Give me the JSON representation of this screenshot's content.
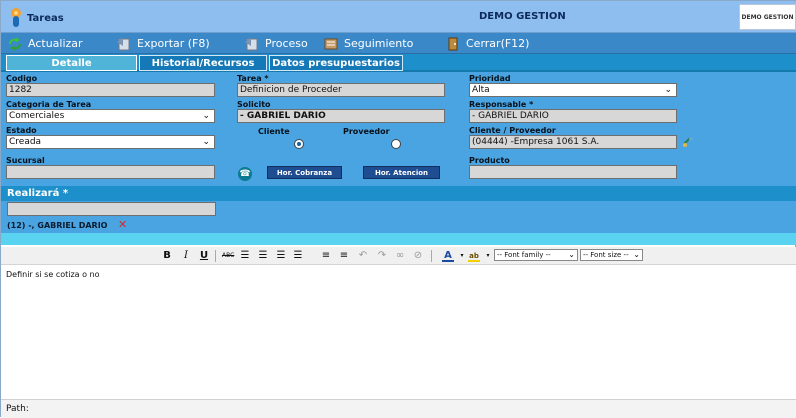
{
  "app": {
    "title": "Tareas",
    "window_title": "DEMO GESTION",
    "brand": "DEMO GESTION"
  },
  "toolbar": {
    "items": [
      {
        "label": "Actualizar",
        "icon": "refresh-icon"
      },
      {
        "label": "Exportar (F8)",
        "icon": "export-icon"
      },
      {
        "label": "Proceso",
        "icon": "process-icon"
      },
      {
        "label": "Seguimiento",
        "icon": "followup-icon"
      },
      {
        "label": "Cerrar(F12)",
        "icon": "close-icon"
      }
    ]
  },
  "tabs": [
    {
      "label": "Detalle",
      "active": true
    },
    {
      "label": "Historial/Recursos",
      "active": false
    },
    {
      "label": "Datos presupuestarios",
      "active": false
    }
  ],
  "form": {
    "codigo": {
      "label": "Codigo",
      "value": "1282"
    },
    "tarea": {
      "label": "Tarea *",
      "value": "Definicion de Proceder"
    },
    "prioridad": {
      "label": "Prioridad",
      "value": "Alta"
    },
    "categoria": {
      "label": "Categoria de Tarea",
      "value": "Comerciales"
    },
    "solicito": {
      "label": "Solicito",
      "value": "- GABRIEL DARIO"
    },
    "responsable": {
      "label": "Responsable *",
      "value": "- GABRIEL DARIO"
    },
    "estado": {
      "label": "Estado",
      "value": "Creada"
    },
    "cliente_radio": {
      "label": "Cliente",
      "checked": true
    },
    "proveedor_radio": {
      "label": "Proveedor",
      "checked": false
    },
    "cliente_proveedor": {
      "label": "Cliente / Proveedor",
      "value": "(04444) -Empresa 1061 S.A."
    },
    "sucursal": {
      "label": "Sucursal",
      "value": ""
    },
    "hor_cobranza": "Hor. Cobranza",
    "hor_atencion": "Hor. Atencion",
    "producto": {
      "label": "Producto",
      "value": ""
    }
  },
  "realizara": {
    "heading": "Realizará *",
    "input_value": "",
    "assigned": "(12) -, GABRIEL DARIO"
  },
  "editor": {
    "bold": "B",
    "italic": "I",
    "underline": "U",
    "strike": "ABC",
    "font_family": "-- Font family --",
    "font_size": "-- Font size --",
    "content": "Definir si se cotiza o no",
    "path_label": "Path:"
  },
  "colors": {
    "titlebar": "#8ebdf0",
    "toolbar": "#3b88c9",
    "tabs": "#1d8fca",
    "form": "#4aa4e1",
    "strip": "#5ad3f1"
  }
}
